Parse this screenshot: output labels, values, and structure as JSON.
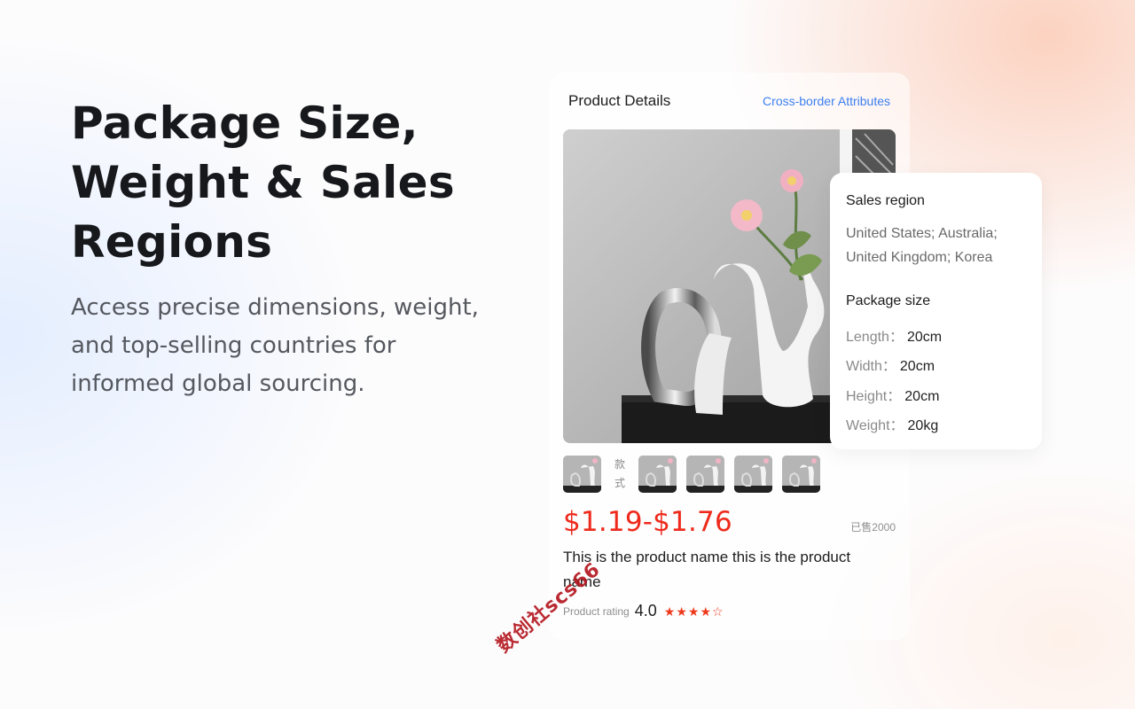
{
  "hero": {
    "title": "Package Size, Weight & Sales Regions",
    "subtitle": "Access precise dimensions, weight, and top-selling countries for informed global sourcing."
  },
  "card": {
    "title": "Product Details",
    "link": "Cross-border Attributes",
    "style_label": "款式",
    "price": "$1.19-$1.76",
    "sold": "已售2000",
    "product_name": "This is the product name this is the product name",
    "rating_label": "Product rating",
    "rating_value": "4.0",
    "rating_stars": 4,
    "rating_max": 5,
    "colors": {
      "price": "#ee2a1c",
      "link": "#3b7ff0"
    }
  },
  "popover": {
    "sales_region_heading": "Sales region",
    "sales_region_value": "United States; Australia; United Kingdom; Korea",
    "package_heading": "Package size",
    "rows": [
      {
        "key": "Length：",
        "value": "20cm"
      },
      {
        "key": "Width：",
        "value": "20cm"
      },
      {
        "key": "Height：",
        "value": "20cm"
      },
      {
        "key": "Weight：",
        "value": "20kg"
      }
    ]
  },
  "watermark": "数创社scs66"
}
